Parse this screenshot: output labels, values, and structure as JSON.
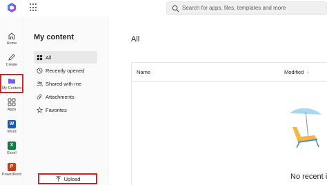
{
  "search": {
    "placeholder": "Search for apps, files, templates and more"
  },
  "rail": {
    "items": [
      {
        "label": "Home"
      },
      {
        "label": "Create"
      },
      {
        "label": "My Content"
      },
      {
        "label": "Apps"
      },
      {
        "label": "Word"
      },
      {
        "label": "Excel"
      },
      {
        "label": "PowerPoint"
      }
    ]
  },
  "panel": {
    "title": "My content",
    "nav": [
      {
        "label": "All"
      },
      {
        "label": "Recently opened"
      },
      {
        "label": "Shared with me"
      },
      {
        "label": "Attachments"
      },
      {
        "label": "Favorites"
      }
    ],
    "upload_label": "Upload"
  },
  "main": {
    "title": "All",
    "columns": {
      "name": "Name",
      "modified": "Modified",
      "sort_arrow": "↓"
    },
    "empty_text": "No recent it"
  },
  "colors": {
    "highlight": "#c62828",
    "word": "#185abd",
    "excel": "#107c41",
    "powerpoint": "#c43e1c",
    "my_content": "#7160e8"
  }
}
